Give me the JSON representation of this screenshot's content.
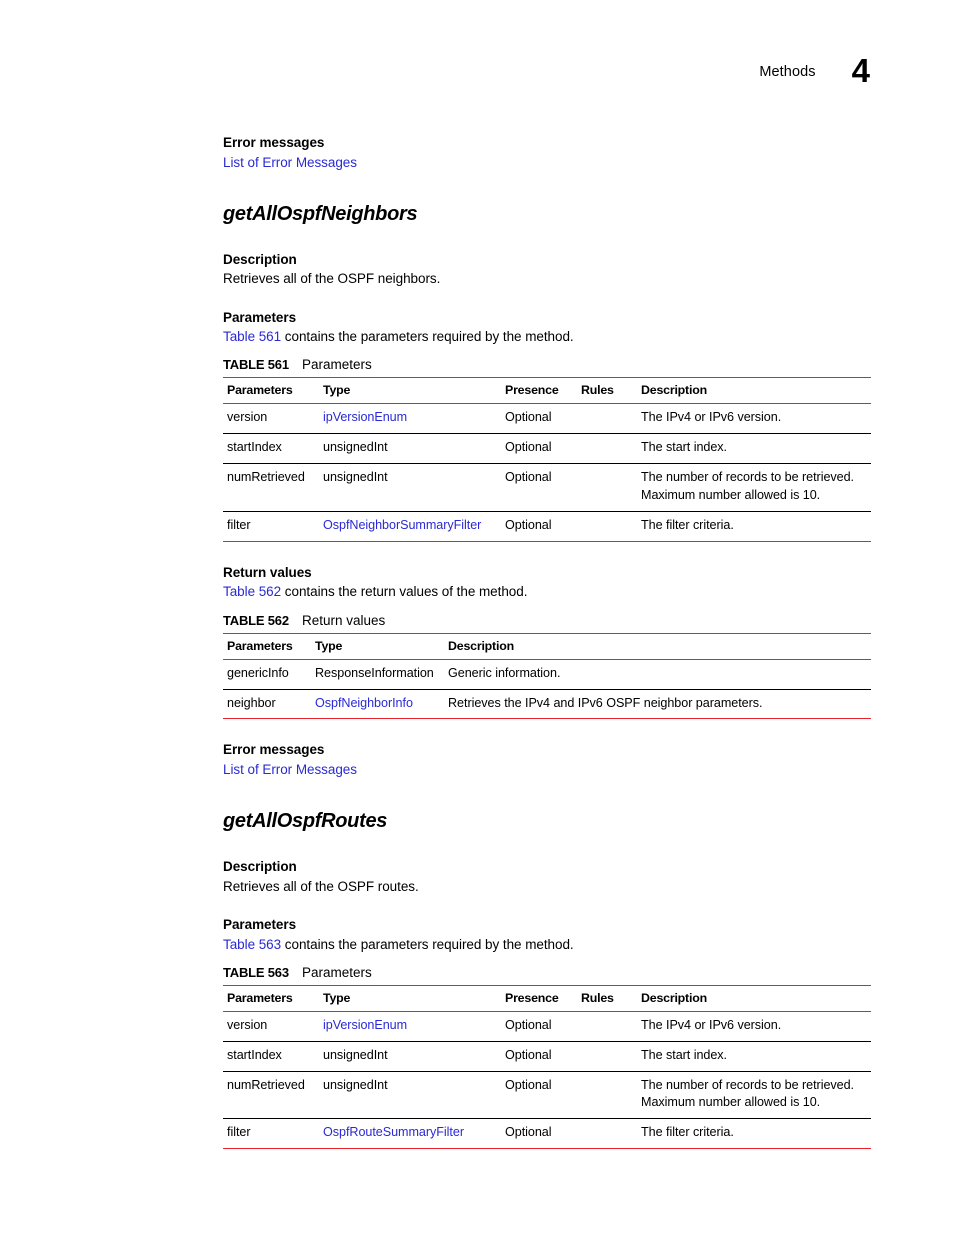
{
  "header": {
    "title": "Methods",
    "chapter": "4"
  },
  "colors": {
    "link": "#2A2AD4",
    "table_rule_red": "#E8212B",
    "text": "#000000"
  },
  "top_block": {
    "error_messages_label": "Error messages",
    "error_messages_link": "List of Error Messages"
  },
  "sections": [
    {
      "id": "getAllOspfNeighbors",
      "method_name": "getAllOspfNeighbors",
      "description_label": "Description",
      "description_text": "Retrieves all of the OSPF neighbors.",
      "parameters_label": "Parameters",
      "parameters_intro_link": "Table 561",
      "parameters_intro_rest": " contains the parameters required by the method.",
      "params_table": {
        "caption_label": "TABLE 561",
        "caption_title": "Parameters",
        "columns": [
          "Parameters",
          "Type",
          "Presence",
          "Rules",
          "Description"
        ],
        "rows": [
          {
            "parameter": "version",
            "type": "ipVersionEnum",
            "type_is_link": true,
            "presence": "Optional",
            "rules": "",
            "description": "The IPv4 or IPv6 version.",
            "description_line2": ""
          },
          {
            "parameter": "startIndex",
            "type": "unsignedInt",
            "type_is_link": false,
            "presence": "Optional",
            "rules": "",
            "description": "The start index.",
            "description_line2": ""
          },
          {
            "parameter": "numRetrieved",
            "type": "unsignedInt",
            "type_is_link": false,
            "presence": "Optional",
            "rules": "",
            "description": "The number of records to be retrieved.",
            "description_line2": "Maximum number allowed is 10."
          },
          {
            "parameter": "filter",
            "type": "OspfNeighborSummaryFilter",
            "type_is_link": true,
            "presence": "Optional",
            "rules": "",
            "description": "The filter criteria.",
            "description_line2": ""
          }
        ]
      },
      "return_values_label": "Return values",
      "return_intro_link": "Table 562",
      "return_intro_rest": " contains the return values of the method.",
      "return_table": {
        "caption_label": "TABLE 562",
        "caption_title": "Return values",
        "columns": [
          "Parameters",
          "Type",
          "Description"
        ],
        "rows": [
          {
            "parameter": "genericInfo",
            "type": "ResponseInformation",
            "type_is_link": false,
            "description": "Generic information."
          },
          {
            "parameter": "neighbor",
            "type": "OspfNeighborInfo",
            "type_is_link": true,
            "description": "Retrieves the IPv4 and IPv6 OSPF neighbor parameters."
          }
        ]
      },
      "error_messages_label": "Error messages",
      "error_messages_link": "List of Error Messages"
    },
    {
      "id": "getAllOspfRoutes",
      "method_name": "getAllOspfRoutes",
      "description_label": "Description",
      "description_text": "Retrieves all of the OSPF routes.",
      "parameters_label": "Parameters",
      "parameters_intro_link": "Table 563",
      "parameters_intro_rest": " contains the parameters required by the method.",
      "params_table": {
        "caption_label": "TABLE 563",
        "caption_title": "Parameters",
        "columns": [
          "Parameters",
          "Type",
          "Presence",
          "Rules",
          "Description"
        ],
        "rows": [
          {
            "parameter": "version",
            "type": "ipVersionEnum",
            "type_is_link": true,
            "presence": "Optional",
            "rules": "",
            "description": "The IPv4 or IPv6 version.",
            "description_line2": ""
          },
          {
            "parameter": "startIndex",
            "type": "unsignedInt",
            "type_is_link": false,
            "presence": "Optional",
            "rules": "",
            "description": "The start index.",
            "description_line2": ""
          },
          {
            "parameter": "numRetrieved",
            "type": "unsignedInt",
            "type_is_link": false,
            "presence": "Optional",
            "rules": "",
            "description": "The number of records to be retrieved.",
            "description_line2": "Maximum number allowed is 10."
          },
          {
            "parameter": "filter",
            "type": "OspfRouteSummaryFilter",
            "type_is_link": true,
            "presence": "Optional",
            "rules": "",
            "description": "The filter criteria.",
            "description_line2": ""
          }
        ]
      }
    }
  ]
}
